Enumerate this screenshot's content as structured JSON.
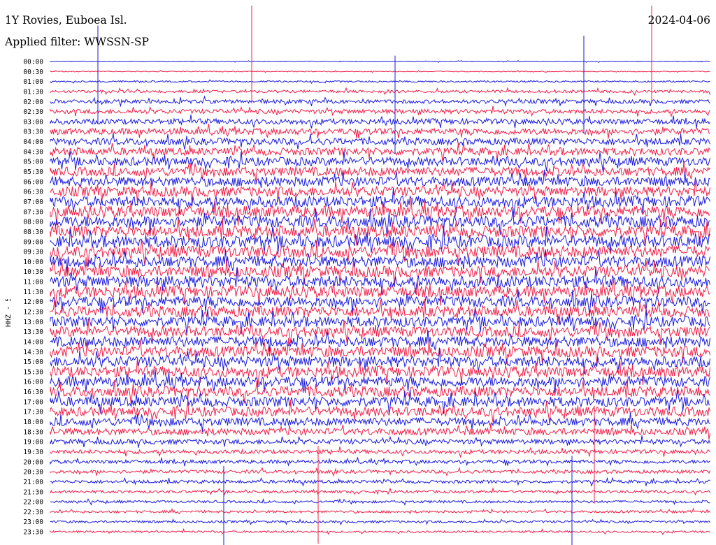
{
  "header": {
    "station": "1Y Rovies, Euboea Isl.",
    "date": "2024-04-06",
    "filter_label": "Applied filter: WWSSN-SP"
  },
  "chart_data": {
    "type": "line",
    "title": "1Y Rovies, Euboea Isl.",
    "subtitle": "Applied filter: WWSSN-SP",
    "date": "2024-04-06",
    "ylabel": "HHZ - 50000",
    "grid": false,
    "trace_colors": [
      "#1a1add",
      "#f01f48"
    ],
    "row_labels": [
      "00:00",
      "00:30",
      "01:00",
      "01:30",
      "02:00",
      "02:30",
      "03:00",
      "03:30",
      "04:00",
      "04:30",
      "05:00",
      "05:30",
      "06:00",
      "06:30",
      "07:00",
      "07:30",
      "08:00",
      "08:30",
      "09:00",
      "09:30",
      "10:00",
      "10:30",
      "11:00",
      "11:30",
      "12:00",
      "12:30",
      "13:00",
      "13:30",
      "14:00",
      "14:30",
      "15:00",
      "15:30",
      "16:00",
      "16:30",
      "17:00",
      "17:30",
      "18:00",
      "18:30",
      "19:00",
      "19:30",
      "20:00",
      "20:30",
      "21:00",
      "21:30",
      "22:00",
      "22:30",
      "23:00",
      "23:30"
    ],
    "noise_level": [
      0.18,
      0.2,
      0.35,
      0.6,
      0.85,
      1.0,
      1.2,
      1.4,
      1.5,
      1.7,
      1.9,
      2.0,
      2.1,
      2.2,
      2.4,
      2.5,
      2.6,
      2.6,
      2.7,
      2.6,
      2.5,
      2.5,
      2.6,
      2.5,
      2.4,
      2.4,
      2.3,
      2.3,
      2.3,
      2.4,
      2.4,
      2.4,
      2.3,
      2.3,
      2.2,
      2.1,
      1.8,
      1.5,
      1.1,
      0.9,
      0.8,
      0.75,
      0.7,
      0.6,
      0.55,
      0.55,
      0.5,
      0.45
    ]
  }
}
